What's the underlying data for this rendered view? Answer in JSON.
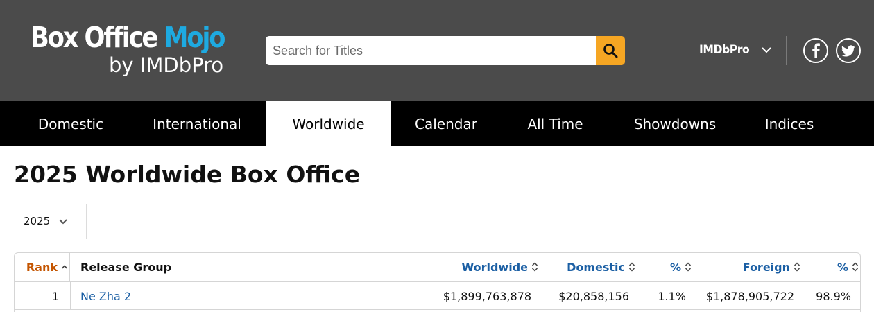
{
  "header": {
    "logo": {
      "box_office": "Box Office",
      "mojo": "Mojo",
      "by_line": "by IMDbPro"
    },
    "search": {
      "placeholder": "Search for Titles",
      "button_icon": "search-icon"
    },
    "imdbpro_menu": {
      "label": "IMDbPro",
      "icon": "chevron-down-icon"
    },
    "social": [
      {
        "name": "facebook",
        "icon": "facebook-icon"
      },
      {
        "name": "twitter",
        "icon": "twitter-icon"
      }
    ],
    "colors": {
      "header_bg": "#4b4b4b",
      "mojo_blue": "#1eaae1",
      "search_button": "#f6a623"
    }
  },
  "nav": {
    "tabs": [
      {
        "label": "Domestic",
        "active": false
      },
      {
        "label": "International",
        "active": false
      },
      {
        "label": "Worldwide",
        "active": true
      },
      {
        "label": "Calendar",
        "active": false
      },
      {
        "label": "All Time",
        "active": false
      },
      {
        "label": "Showdowns",
        "active": false
      },
      {
        "label": "Indices",
        "active": false
      }
    ]
  },
  "page": {
    "title": "2025 Worldwide Box Office",
    "year_selector": {
      "value": "2025",
      "icon": "chevron-down-icon"
    }
  },
  "table": {
    "columns": [
      {
        "label": "Rank",
        "sorted": true,
        "sort_icon": "sort-up-icon"
      },
      {
        "label": "Release Group",
        "sortable": false
      },
      {
        "label": "Worldwide",
        "sort_icon": "sort-icon"
      },
      {
        "label": "Domestic",
        "sort_icon": "sort-icon"
      },
      {
        "label": "%",
        "sort_icon": "sort-icon"
      },
      {
        "label": "Foreign",
        "sort_icon": "sort-icon"
      },
      {
        "label": "%",
        "sort_icon": "sort-icon"
      }
    ],
    "rows": [
      {
        "rank": "1",
        "release_group": "Ne Zha 2",
        "worldwide": "$1,899,763,878",
        "domestic": "$20,858,156",
        "domestic_pct": "1.1%",
        "foreign": "$1,878,905,722",
        "foreign_pct": "98.9%"
      }
    ],
    "colors": {
      "link": "#1b5fa4",
      "sorted_header": "#c45500"
    }
  }
}
